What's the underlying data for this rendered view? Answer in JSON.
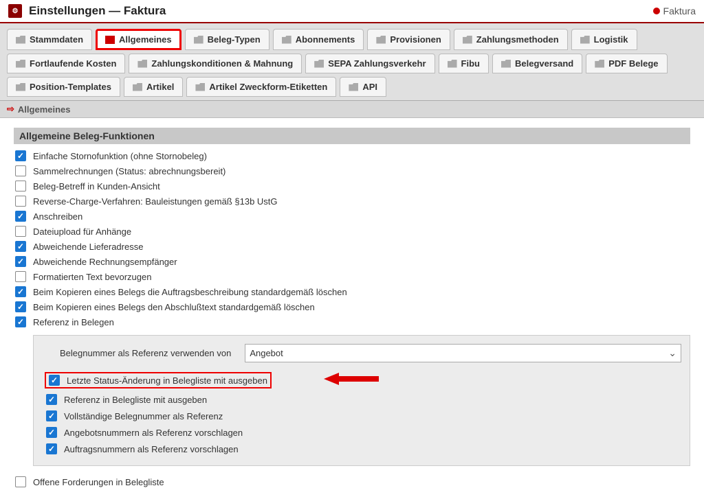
{
  "header": {
    "title": "Einstellungen — Faktura",
    "brand": "Faktura"
  },
  "tabs": {
    "row1": [
      {
        "label": "Stammdaten"
      },
      {
        "label": "Allgemeines",
        "active": true
      },
      {
        "label": "Beleg-Typen"
      },
      {
        "label": "Abonnements"
      },
      {
        "label": "Provisionen"
      },
      {
        "label": "Zahlungsmethoden"
      },
      {
        "label": "Logistik"
      }
    ],
    "row2": [
      {
        "label": "Fortlaufende Kosten"
      },
      {
        "label": "Zahlungskonditionen & Mahnung"
      },
      {
        "label": "SEPA Zahlungsverkehr"
      },
      {
        "label": "Fibu"
      },
      {
        "label": "Belegversand"
      },
      {
        "label": "PDF Belege"
      }
    ],
    "row3": [
      {
        "label": "Position-Templates"
      },
      {
        "label": "Artikel"
      },
      {
        "label": "Artikel Zweckform-Etiketten"
      },
      {
        "label": "API"
      }
    ]
  },
  "subheader": "Allgemeines",
  "section_title": "Allgemeine Beleg-Funktionen",
  "options": [
    {
      "label": "Einfache Stornofunktion (ohne Stornobeleg)",
      "checked": true
    },
    {
      "label": "Sammelrechnungen (Status: abrechnungsbereit)",
      "checked": false
    },
    {
      "label": "Beleg-Betreff in Kunden-Ansicht",
      "checked": false
    },
    {
      "label": "Reverse-Charge-Verfahren: Bauleistungen gemäß §13b UstG",
      "checked": false
    },
    {
      "label": "Anschreiben",
      "checked": true
    },
    {
      "label": "Dateiupload für Anhänge",
      "checked": false
    },
    {
      "label": "Abweichende Lieferadresse",
      "checked": true
    },
    {
      "label": "Abweichende Rechnungsempfänger",
      "checked": true
    },
    {
      "label": "Formatierten Text bevorzugen",
      "checked": false
    },
    {
      "label": "Beim Kopieren eines Belegs die Auftragsbeschreibung standardgemäß löschen",
      "checked": true
    },
    {
      "label": "Beim Kopieren eines Belegs den Abschlußtext standardgemäß löschen",
      "checked": true
    },
    {
      "label": "Referenz in Belegen",
      "checked": true
    }
  ],
  "inset": {
    "select_label": "Belegnummer als Referenz verwenden von",
    "select_value": "Angebot",
    "items": [
      {
        "label": "Letzte Status-Änderung in Belegliste mit ausgeben",
        "checked": true,
        "highlight": true
      },
      {
        "label": "Referenz in Belegliste mit ausgeben",
        "checked": true
      },
      {
        "label": "Vollständige Belegnummer als Referenz",
        "checked": true
      },
      {
        "label": "Angebotsnummern als Referenz vorschlagen",
        "checked": true
      },
      {
        "label": "Auftragsnummern als Referenz vorschlagen",
        "checked": true
      }
    ]
  },
  "bottom": {
    "label": "Offene Forderungen in Belegliste",
    "checked": false
  }
}
